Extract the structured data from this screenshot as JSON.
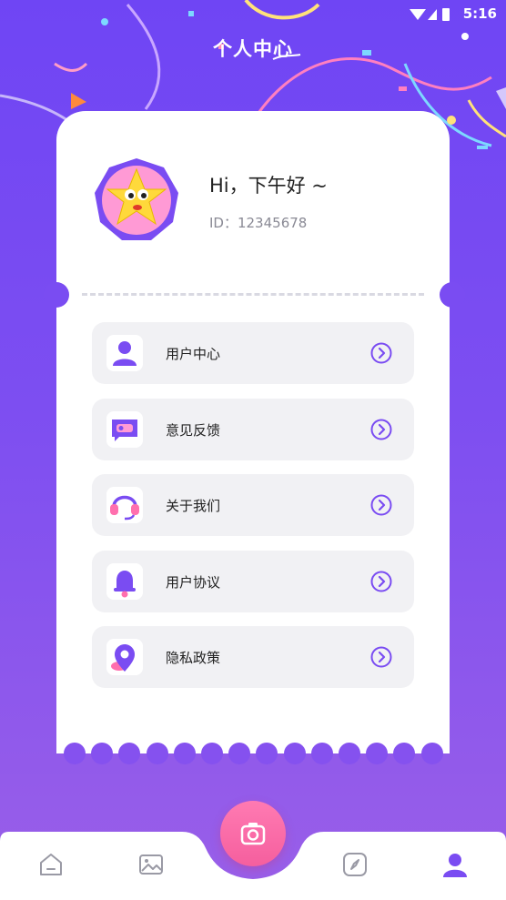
{
  "status_bar": {
    "time": "5:16"
  },
  "header": {
    "title": "个人中心"
  },
  "profile": {
    "greeting": "Hi，下午好 ~",
    "user_id": "ID：12345678"
  },
  "menu": {
    "items": [
      {
        "label": "用户中心",
        "icon": "user-icon"
      },
      {
        "label": "意见反馈",
        "icon": "feedback-icon"
      },
      {
        "label": "关于我们",
        "icon": "headset-icon"
      },
      {
        "label": "用户协议",
        "icon": "bell-icon"
      },
      {
        "label": "隐私政策",
        "icon": "location-pin-icon"
      }
    ]
  },
  "tab_bar": {
    "tabs": [
      {
        "icon": "home-icon",
        "active": false
      },
      {
        "icon": "gallery-icon",
        "active": false
      },
      {
        "icon": "camera-icon",
        "active": false
      },
      {
        "icon": "compass-icon",
        "active": false
      },
      {
        "icon": "profile-icon",
        "active": true
      }
    ]
  },
  "colors": {
    "primary": "#7a4cf2",
    "accent_pink": "#f55f9e",
    "card_bg": "#ffffff",
    "item_bg": "#f1f1f4"
  }
}
